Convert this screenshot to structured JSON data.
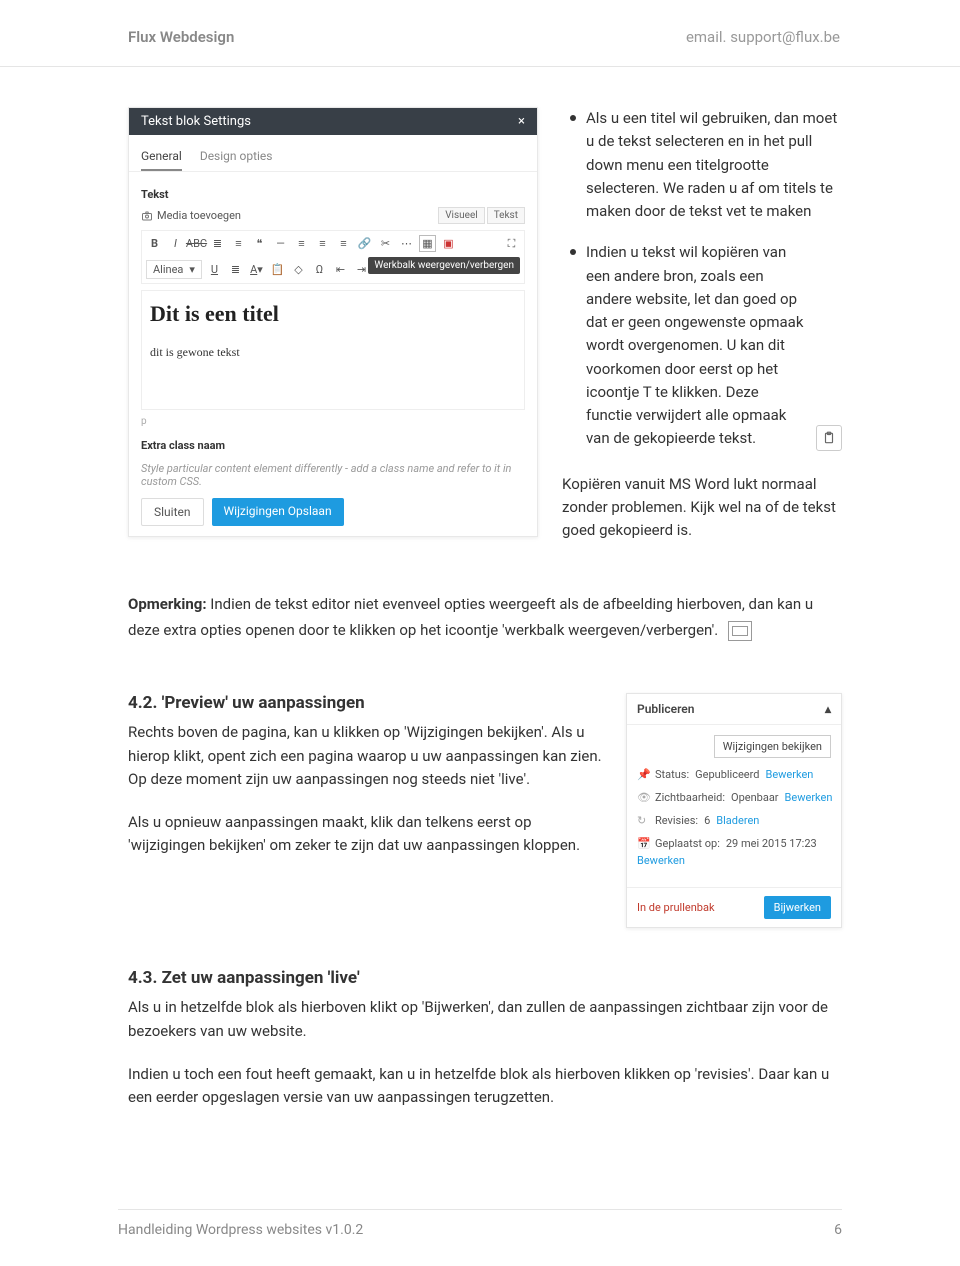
{
  "header": {
    "brand": "Flux  Webdesign",
    "email": "email. support@flux.be"
  },
  "editor": {
    "title": "Tekst blok Settings",
    "tab_general": "General",
    "tab_design": "Design opties",
    "label_tekst": "Tekst",
    "media_btn": "Media toevoegen",
    "view_visual": "Visueel",
    "view_text": "Tekst",
    "format_select": "Alinea",
    "tooltip": "Werkbalk weergeven/verbergen",
    "body_title": "Dit is een titel",
    "body_text": "dit is gewone tekst",
    "pfoot": "p",
    "extra_class_label": "Extra class naam",
    "hint": "Style particular content element differently - add a class name and refer to it in custom CSS.",
    "btn_close": "Sluiten",
    "btn_save": "Wijzigingen Opslaan"
  },
  "bullets": {
    "b1": "Als u een titel wil gebruiken, dan moet u de tekst selecteren en in het pull down menu een titelgrootte selecteren. We raden u af om titels te maken door de tekst vet te maken",
    "b2": "Indien u tekst wil kopiëren van een andere bron, zoals een andere website, let dan goed op dat er geen ongewenste opmaak wordt overgenomen. U kan dit voorkomen door eerst op het icoontje T te klikken. Deze functie verwijdert alle opmaak van de gekopieerde tekst.",
    "after": "Kopiëren vanuit MS Word lukt normaal zonder problemen. Kijk wel na of de tekst goed gekopieerd is."
  },
  "note": {
    "bold": "Opmerking:",
    "text": " Indien de tekst editor niet evenveel opties weergeeft als de afbeelding hierboven, dan kan u deze extra opties openen door te klikken op het icoontje 'werkbalk weergeven/verbergen'."
  },
  "sec42": {
    "h": "4.2. 'Preview' uw aanpassingen",
    "p1": "Rechts boven de pagina, kan u klikken op 'Wijzigingen bekijken'. Als u hierop klikt, opent zich een pagina waarop u uw aanpassingen kan zien. Op deze moment zijn uw aanpassingen nog steeds niet 'live'.",
    "p2": "Als u opnieuw aanpassingen maakt, klik dan telkens eerst op 'wijzigingen bekijken' om zeker te zijn dat uw aanpassingen kloppen."
  },
  "publish": {
    "title": "Publiceren",
    "preview_btn": "Wijzigingen bekijken",
    "status_label": "Status:",
    "status_val": "Gepubliceerd",
    "status_edit": "Bewerken",
    "vis_label": "Zichtbaarheid:",
    "vis_val": "Openbaar",
    "vis_edit": "Bewerken",
    "rev_label": "Revisies:",
    "rev_val": "6",
    "rev_browse": "Bladeren",
    "date_label": "Geplaatst op:",
    "date_val": "29 mei 2015 17:23",
    "date_edit": "Bewerken",
    "trash": "In de prullenbak",
    "update": "Bijwerken"
  },
  "sec43": {
    "h": "4.3.  Zet uw aanpassingen 'live'",
    "p1": "Als u in hetzelfde blok als hierboven klikt op 'Bijwerken', dan zullen de aanpassingen zichtbaar zijn voor de bezoekers van uw website.",
    "p2": "Indien u toch een fout heeft gemaakt, kan u in hetzelfde blok als hierboven klikken op 'revisies'. Daar kan u een eerder opgeslagen versie van uw aanpassingen terugzetten."
  },
  "footer": {
    "title": "Handleiding Wordpress websites v1.0.2",
    "page": "6"
  }
}
